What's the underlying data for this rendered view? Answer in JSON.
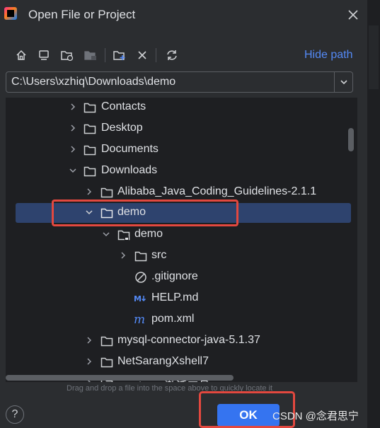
{
  "dialog": {
    "title": "Open File or Project",
    "hide_path_label": "Hide path",
    "path_value": "C:\\Users\\xzhiq\\Downloads\\demo",
    "hint": "Drag and drop a file into the space above to quickly locate it",
    "ok_label": "OK",
    "help_label": "?"
  },
  "toolbar": {
    "icons": [
      "home-icon",
      "desktop-icon",
      "new-folder-icon",
      "project-folder-icon",
      "add-folder-icon",
      "delete-icon",
      "refresh-icon"
    ]
  },
  "tree": {
    "rows": [
      {
        "label": "Contacts",
        "icon": "folder-icon"
      },
      {
        "label": "Desktop",
        "icon": "folder-icon"
      },
      {
        "label": "Documents",
        "icon": "folder-icon"
      },
      {
        "label": "Downloads",
        "icon": "folder-icon"
      },
      {
        "label": "Alibaba_Java_Coding_Guidelines-2.1.1",
        "icon": "folder-icon"
      },
      {
        "label": "demo",
        "icon": "folder-icon"
      },
      {
        "label": "demo",
        "icon": "project-folder-icon"
      },
      {
        "label": "src",
        "icon": "folder-icon"
      },
      {
        "label": ".gitignore",
        "icon": "ignore-file-icon"
      },
      {
        "label": "HELP.md",
        "icon": "markdown-icon"
      },
      {
        "label": "pom.xml",
        "icon": "maven-icon"
      },
      {
        "label": "mysql-connector-java-5.1.37",
        "icon": "folder-icon"
      },
      {
        "label": "NetSarangXshell7",
        "icon": "folder-icon"
      },
      {
        "label": "PyCharm激活工具",
        "icon": "folder-icon"
      }
    ]
  },
  "watermark": "CSDN @念君思宁",
  "colors": {
    "background": "#2b2d30",
    "tree_background": "#1e1f22",
    "selection": "#2e436e",
    "accent": "#3574f0",
    "link": "#548af7",
    "highlight_box": "#e3483f"
  }
}
